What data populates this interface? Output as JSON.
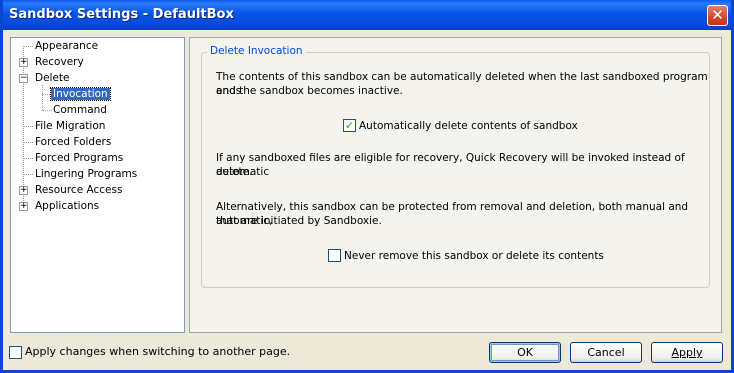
{
  "window": {
    "title": "Sandbox Settings - DefaultBox"
  },
  "tree": {
    "items": [
      {
        "label": "Appearance",
        "expander": ""
      },
      {
        "label": "Recovery",
        "expander": "+"
      },
      {
        "label": "Delete",
        "expander": "−"
      },
      {
        "label": "Invocation",
        "expander": "",
        "selected": true
      },
      {
        "label": "Command",
        "expander": ""
      },
      {
        "label": "File Migration",
        "expander": ""
      },
      {
        "label": "Forced Folders",
        "expander": ""
      },
      {
        "label": "Forced Programs",
        "expander": ""
      },
      {
        "label": "Lingering Programs",
        "expander": ""
      },
      {
        "label": "Resource Access",
        "expander": "+"
      },
      {
        "label": "Applications",
        "expander": "+"
      }
    ]
  },
  "group": {
    "title": "Delete Invocation",
    "desc1_line1": "The contents of this sandbox can be automatically deleted when the last sandboxed program ends",
    "desc1_line2": "and the sandbox becomes inactive.",
    "auto_delete": {
      "label": "Automatically delete contents of sandbox",
      "checked": true
    },
    "desc2_line1": "If any sandboxed files are eligible for recovery, Quick Recovery will be invoked instead of automatic",
    "desc2_line2": "delete.",
    "desc3_line1": "Alternatively, this sandbox can be protected from removal and deletion, both manual and automatic,",
    "desc3_line2": "that are initiated by Sandboxie.",
    "never_remove": {
      "label": "Never remove this sandbox or delete its contents",
      "checked": false
    }
  },
  "footer": {
    "apply_on_switch": {
      "label": "Apply changes when switching to another page.",
      "checked": false
    },
    "ok_label": "OK",
    "cancel_label": "Cancel",
    "apply_label": "Apply"
  }
}
